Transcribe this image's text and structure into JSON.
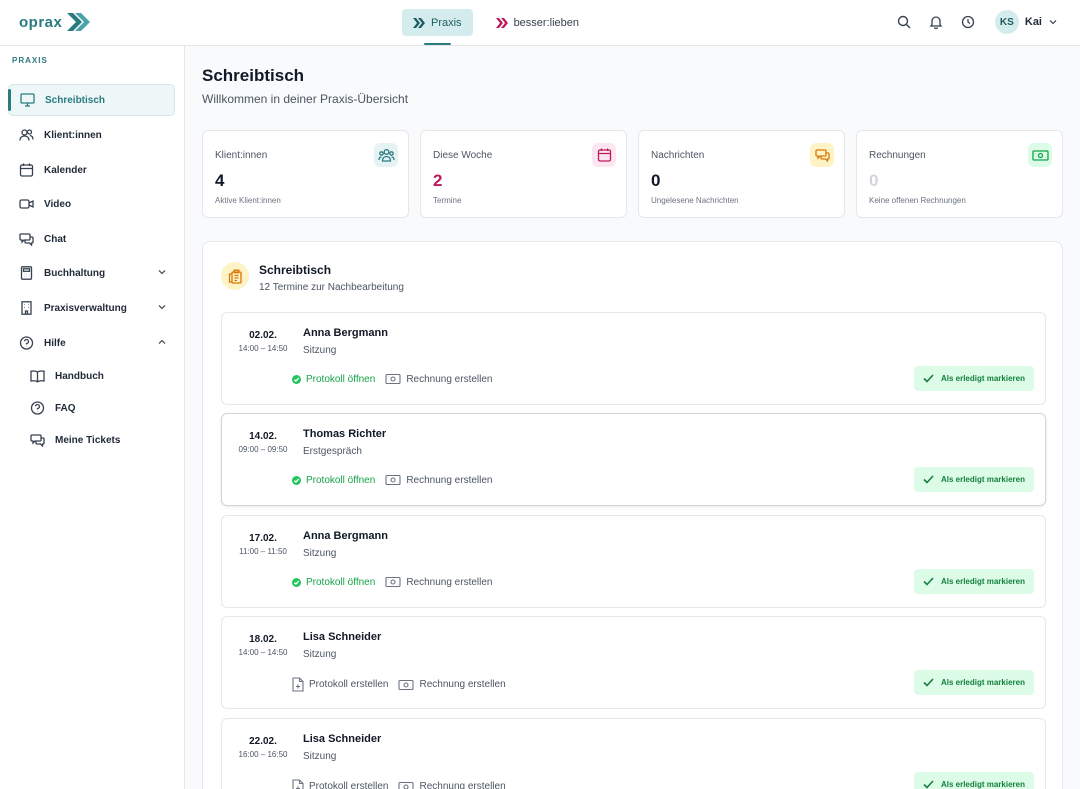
{
  "brand": {
    "name": "oprax"
  },
  "header": {
    "tabs": [
      {
        "label": "Praxis",
        "active": true
      },
      {
        "label": "besser:lieben",
        "active": false
      }
    ],
    "user": {
      "initials": "KS",
      "name": "Kai"
    }
  },
  "sidebar": {
    "section_label": "PRAXIS",
    "items": [
      {
        "label": "Schreibtisch",
        "icon": "monitor-icon",
        "active": true
      },
      {
        "label": "Klient:innen",
        "icon": "users-icon"
      },
      {
        "label": "Kalender",
        "icon": "calendar-icon"
      },
      {
        "label": "Video",
        "icon": "video-icon"
      },
      {
        "label": "Chat",
        "icon": "chat-icon"
      },
      {
        "label": "Buchhaltung",
        "icon": "calculator-icon",
        "expandable": true,
        "expanded": false
      },
      {
        "label": "Praxisverwaltung",
        "icon": "building-icon",
        "expandable": true,
        "expanded": false
      },
      {
        "label": "Hilfe",
        "icon": "help-icon",
        "expandable": true,
        "expanded": true
      }
    ],
    "help_subitems": [
      {
        "label": "Handbuch",
        "icon": "book-icon"
      },
      {
        "label": "FAQ",
        "icon": "help-icon"
      },
      {
        "label": "Meine Tickets",
        "icon": "chat-icon"
      }
    ]
  },
  "page": {
    "title": "Schreibtisch",
    "subtitle": "Willkommen in deiner Praxis-Übersicht"
  },
  "stats": [
    {
      "label": "Klient:innen",
      "value": "4",
      "hint": "Aktive Klient:innen",
      "icon": "users-icon",
      "color": "#2a7b80"
    },
    {
      "label": "Diese Woche",
      "value": "2",
      "hint": "Termine",
      "icon": "calendar-icon",
      "color": "#be185d"
    },
    {
      "label": "Nachrichten",
      "value": "0",
      "hint": "Ungelesene Nachrichten",
      "icon": "chat-icon",
      "color": "#d97706"
    },
    {
      "label": "Rechnungen",
      "value": "0",
      "hint": "Keine offenen Rechnungen",
      "icon": "banknote-icon",
      "color": "#16a34a"
    }
  ],
  "panel": {
    "title": "Schreibtisch",
    "subtitle": "12 Termine zur Nachbearbeitung",
    "mark_done_label": "Als erledigt markieren",
    "protocol_open_label": "Protokoll öffnen",
    "protocol_create_label": "Protokoll erstellen",
    "invoice_create_label": "Rechnung erstellen"
  },
  "appointments": [
    {
      "date": "02.02.",
      "time": "14:00 – 14:50",
      "name": "Anna Bergmann",
      "type": "Sitzung",
      "has_protocol": true
    },
    {
      "date": "14.02.",
      "time": "09:00 – 09:50",
      "name": "Thomas Richter",
      "type": "Erstgespräch",
      "has_protocol": true
    },
    {
      "date": "17.02.",
      "time": "11:00 – 11:50",
      "name": "Anna Bergmann",
      "type": "Sitzung",
      "has_protocol": true
    },
    {
      "date": "18.02.",
      "time": "14:00 – 14:50",
      "name": "Lisa Schneider",
      "type": "Sitzung",
      "has_protocol": false
    },
    {
      "date": "22.02.",
      "time": "16:00 – 16:50",
      "name": "Lisa Schneider",
      "type": "Sitzung",
      "has_protocol": false
    }
  ]
}
